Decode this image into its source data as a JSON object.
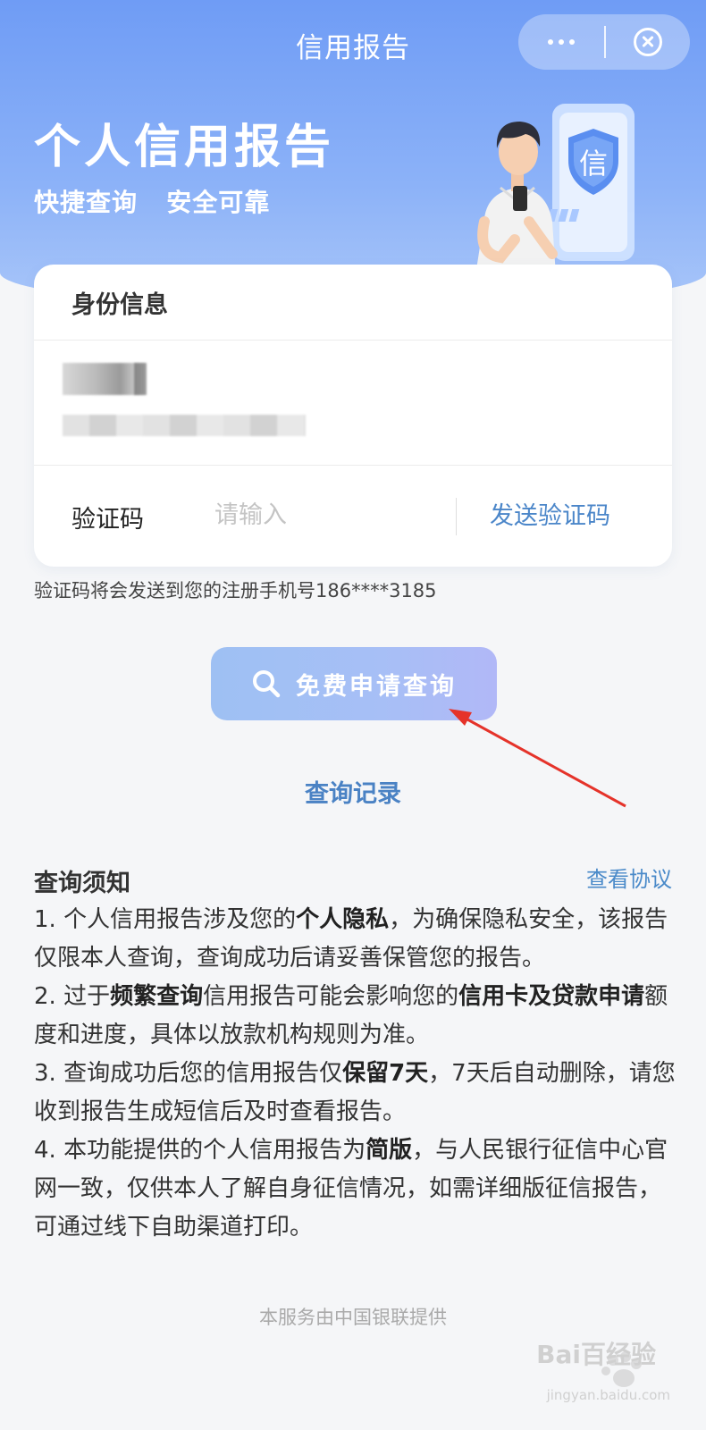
{
  "nav": {
    "title": "信用报告"
  },
  "hero": {
    "title": "个人信用报告",
    "subtitle": "快捷查询   安全可靠",
    "badge_char": "信"
  },
  "identity_card": {
    "header": "身份信息",
    "code_label": "验证码",
    "code_placeholder": "请输入",
    "send_code_label": "发送验证码"
  },
  "hint_text": "验证码将会发送到您的注册手机号186****3185",
  "apply_button_label": "免费申请查询",
  "records_link_label": "查询记录",
  "notice": {
    "title": "查询须知",
    "agreement_link": "查看协议",
    "items": [
      {
        "p1": "1. 个人信用报告涉及您的",
        "b1": "个人隐私",
        "p2": "，为确保隐私安全，该报告仅限本人查询，查询成功后请妥善保管您的报告。"
      },
      {
        "p1": "2. 过于",
        "b1": "频繁查询",
        "p2": "信用报告可能会影响您的",
        "b2": "信用卡及贷款申请",
        "p3": "额度和进度，具体以放款机构规则为准。"
      },
      {
        "p1": "3. 查询成功后您的信用报告仅",
        "b1": "保留7天",
        "p2": "，7天后自动删除，请您收到报告生成短信后及时查看报告。"
      },
      {
        "p1": "4. 本功能提供的个人信用报告为",
        "b1": "简版",
        "p2": "，与人民银行征信中心官网一致，仅供本人了解自身征信情况，如需详细版征信报告，可通过线下自助渠道打印。"
      }
    ]
  },
  "footer_text": "本服务由中国银联提供",
  "watermark": {
    "brand": "Bai百经验",
    "site": "jingyan.baidu.com"
  },
  "colors": {
    "hero": "#7aa5f6",
    "link": "#4a82c4",
    "arrow": "#e5332a"
  }
}
